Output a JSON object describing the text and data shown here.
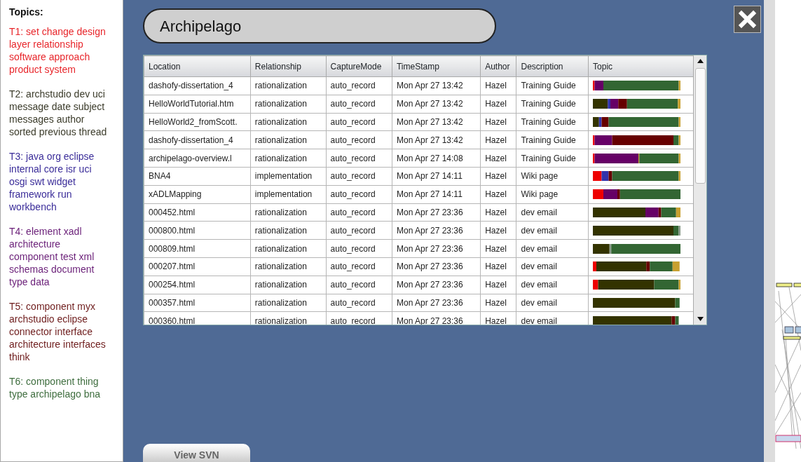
{
  "sidebar": {
    "title": "Topics:",
    "topics": [
      {
        "text": "T1: set change design layer relationship software approach product system",
        "color": "#e8262b"
      },
      {
        "text": "T2: archstudio dev uci message date subject messages author sorted previous thread",
        "color": "#3b3b2a"
      },
      {
        "text": "T3: java org eclipse internal core isr uci osgi swt widget framework run workbench",
        "color": "#3a2c99"
      },
      {
        "text": "T4: element xadl architecture component test xml schemas document type data",
        "color": "#6a1f78"
      },
      {
        "text": "T5: component myx archstudio eclipse connector interface architecture interfaces think",
        "color": "#6e1c1c"
      },
      {
        "text": "T6: component thing type archipelago bna",
        "color": "#3f6e3f"
      }
    ]
  },
  "title": "Archipelago",
  "table": {
    "columns": [
      "Location",
      "Relationship",
      "CaptureMode",
      "TimeStamp",
      "Author",
      "Description",
      "Topic"
    ],
    "rows": [
      {
        "cells": [
          "dashofy-dissertation_4",
          "rationalization",
          "auto_record",
          "Mon Apr 27 13:42",
          "Hazel",
          "Training Guide"
        ]
      },
      {
        "cells": [
          "HelloWorldTutorial.htm",
          "rationalization",
          "auto_record",
          "Mon Apr 27 13:42",
          "Hazel",
          "Training Guide"
        ]
      },
      {
        "cells": [
          "HelloWorld2_fromScott.",
          "rationalization",
          "auto_record",
          "Mon Apr 27 13:42",
          "Hazel",
          "Training Guide"
        ]
      },
      {
        "cells": [
          "dashofy-dissertation_4",
          "rationalization",
          "auto_record",
          "Mon Apr 27 13:42",
          "Hazel",
          "Training Guide"
        ]
      },
      {
        "cells": [
          "archipelago-overview.l",
          "rationalization",
          "auto_record",
          "Mon Apr 27 14:08",
          "Hazel",
          "Training Guide"
        ]
      },
      {
        "cells": [
          "BNA4",
          "implementation",
          "auto_record",
          "Mon Apr 27 14:11",
          "Hazel",
          "Wiki page"
        ]
      },
      {
        "cells": [
          "xADLMapping",
          "implementation",
          "auto_record",
          "Mon Apr 27 14:11",
          "Hazel",
          "Wiki page"
        ]
      },
      {
        "cells": [
          "000452.html",
          "rationalization",
          "auto_record",
          "Mon Apr 27 23:36",
          "Hazel",
          "dev email"
        ]
      },
      {
        "cells": [
          "000800.html",
          "rationalization",
          "auto_record",
          "Mon Apr 27 23:36",
          "Hazel",
          "dev email"
        ]
      },
      {
        "cells": [
          "000809.html",
          "rationalization",
          "auto_record",
          "Mon Apr 27 23:36",
          "Hazel",
          "dev email"
        ]
      },
      {
        "cells": [
          "000207.html",
          "rationalization",
          "auto_record",
          "Mon Apr 27 23:36",
          "Hazel",
          "dev email"
        ]
      },
      {
        "cells": [
          "000254.html",
          "rationalization",
          "auto_record",
          "Mon Apr 27 23:36",
          "Hazel",
          "dev email"
        ]
      },
      {
        "cells": [
          "000357.html",
          "rationalization",
          "auto_record",
          "Mon Apr 27 23:36",
          "Hazel",
          "dev email"
        ]
      },
      {
        "cells": [
          "000360.html",
          "rationalization",
          "auto_record",
          "Mon Apr 27 23:36",
          "Hazel",
          "dev email"
        ]
      }
    ]
  },
  "view_button": "View SVN"
}
